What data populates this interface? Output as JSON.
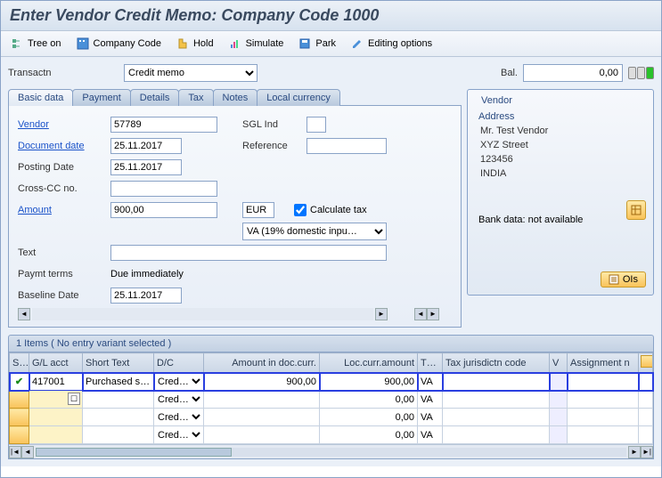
{
  "title": "Enter Vendor Credit Memo: Company Code 1000",
  "toolbar": {
    "tree_on": "Tree on",
    "company_code": "Company Code",
    "hold": "Hold",
    "simulate": "Simulate",
    "park": "Park",
    "editing_options": "Editing options"
  },
  "transaction": {
    "label": "Transactn",
    "value": "Credit memo"
  },
  "balance": {
    "label": "Bal.",
    "value": "0,00"
  },
  "tabs": [
    "Basic data",
    "Payment",
    "Details",
    "Tax",
    "Notes",
    "Local currency"
  ],
  "active_tab": 0,
  "form": {
    "vendor_label": "Vendor",
    "vendor": "57789",
    "sgl_ind_label": "SGL Ind",
    "sgl_ind": "",
    "doc_date_label": "Document date",
    "doc_date": "25.11.2017",
    "reference_label": "Reference",
    "reference": "",
    "posting_date_label": "Posting Date",
    "posting_date": "25.11.2017",
    "cross_cc_label": "Cross-CC no.",
    "cross_cc": "",
    "amount_label": "Amount",
    "amount": "900,00",
    "currency": "EUR",
    "calc_tax_label": "Calculate tax",
    "calc_tax": true,
    "tax_code": "VA (19% domestic inpu…",
    "text_label": "Text",
    "text": "",
    "paymt_terms_label": "Paymt terms",
    "paymt_terms": "Due immediately",
    "baseline_date_label": "Baseline Date",
    "baseline_date": "25.11.2017"
  },
  "vendor_box": {
    "title": "Vendor",
    "address_title": "Address",
    "lines": [
      "Mr. Test Vendor",
      "XYZ Street",
      "123456",
      "INDIA"
    ],
    "bank_text": "Bank data: not available",
    "ois_btn": "OIs"
  },
  "items_header": "1 Items ( No entry variant selected )",
  "grid": {
    "columns": [
      "S…",
      "G/L acct",
      "Short Text",
      "D/C",
      "Amount in doc.curr.",
      "Loc.curr.amount",
      "T…",
      "Tax jurisdictn code",
      "V",
      "Assignment n"
    ],
    "rows": [
      {
        "status": "ok",
        "gl": "417001",
        "short": "Purchased s…",
        "dc": "Cred…",
        "amt_doc": "900,00",
        "amt_loc": "900,00",
        "tax": "VA",
        "jur": "",
        "v": "",
        "assign": ""
      },
      {
        "status": "",
        "gl": "",
        "short": "",
        "dc": "Cred…",
        "amt_doc": "",
        "amt_loc": "0,00",
        "tax": "VA",
        "jur": "",
        "v": "",
        "assign": ""
      },
      {
        "status": "",
        "gl": "",
        "short": "",
        "dc": "Cred…",
        "amt_doc": "",
        "amt_loc": "0,00",
        "tax": "VA",
        "jur": "",
        "v": "",
        "assign": ""
      },
      {
        "status": "",
        "gl": "",
        "short": "",
        "dc": "Cred…",
        "amt_doc": "",
        "amt_loc": "0,00",
        "tax": "VA",
        "jur": "",
        "v": "",
        "assign": ""
      }
    ]
  }
}
